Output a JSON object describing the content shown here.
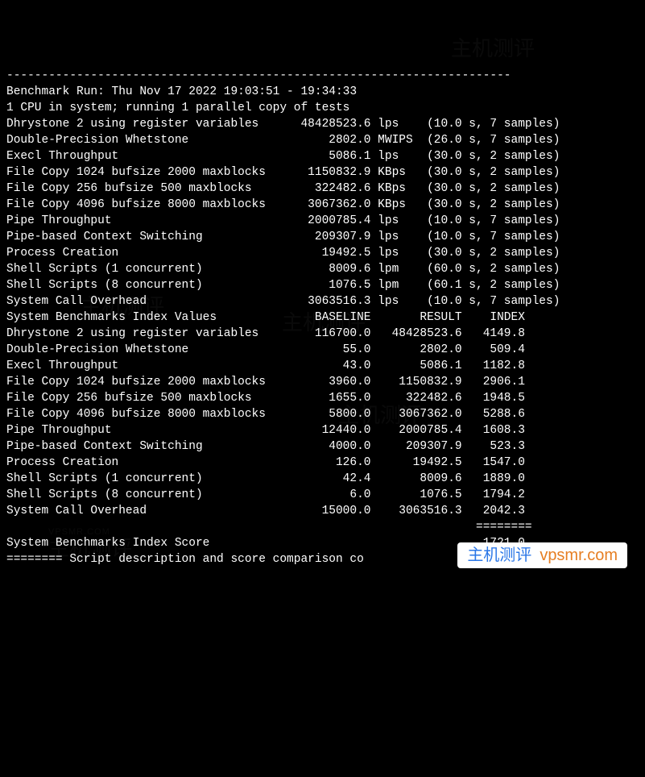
{
  "header": {
    "divider_top": "------------------------------------------------------------------------",
    "run_line": "Benchmark Run: Thu Nov 17 2022 19:03:51 - 19:34:33",
    "cpu_line": "1 CPU in system; running 1 parallel copy of tests"
  },
  "results": [
    {
      "name": "Dhrystone 2 using register variables",
      "value": "48428523.6",
      "unit": "lps",
      "time": "10.0",
      "samples": "7"
    },
    {
      "name": "Double-Precision Whetstone",
      "value": "2802.0",
      "unit": "MWIPS",
      "time": "26.0",
      "samples": "7"
    },
    {
      "name": "Execl Throughput",
      "value": "5086.1",
      "unit": "lps",
      "time": "30.0",
      "samples": "2"
    },
    {
      "name": "File Copy 1024 bufsize 2000 maxblocks",
      "value": "1150832.9",
      "unit": "KBps",
      "time": "30.0",
      "samples": "2"
    },
    {
      "name": "File Copy 256 bufsize 500 maxblocks",
      "value": "322482.6",
      "unit": "KBps",
      "time": "30.0",
      "samples": "2"
    },
    {
      "name": "File Copy 4096 bufsize 8000 maxblocks",
      "value": "3067362.0",
      "unit": "KBps",
      "time": "30.0",
      "samples": "2"
    },
    {
      "name": "Pipe Throughput",
      "value": "2000785.4",
      "unit": "lps",
      "time": "10.0",
      "samples": "7"
    },
    {
      "name": "Pipe-based Context Switching",
      "value": "209307.9",
      "unit": "lps",
      "time": "10.0",
      "samples": "7"
    },
    {
      "name": "Process Creation",
      "value": "19492.5",
      "unit": "lps",
      "time": "30.0",
      "samples": "2"
    },
    {
      "name": "Shell Scripts (1 concurrent)",
      "value": "8009.6",
      "unit": "lpm",
      "time": "60.0",
      "samples": "2"
    },
    {
      "name": "Shell Scripts (8 concurrent)",
      "value": "1076.5",
      "unit": "lpm",
      "time": "60.1",
      "samples": "2"
    },
    {
      "name": "System Call Overhead",
      "value": "3063516.3",
      "unit": "lps",
      "time": "10.0",
      "samples": "7"
    }
  ],
  "index_header": {
    "title": "System Benchmarks Index Values",
    "baseline": "BASELINE",
    "result": "RESULT",
    "index": "INDEX"
  },
  "index": [
    {
      "name": "Dhrystone 2 using register variables",
      "baseline": "116700.0",
      "result": "48428523.6",
      "index": "4149.8"
    },
    {
      "name": "Double-Precision Whetstone",
      "baseline": "55.0",
      "result": "2802.0",
      "index": "509.4"
    },
    {
      "name": "Execl Throughput",
      "baseline": "43.0",
      "result": "5086.1",
      "index": "1182.8"
    },
    {
      "name": "File Copy 1024 bufsize 2000 maxblocks",
      "baseline": "3960.0",
      "result": "1150832.9",
      "index": "2906.1"
    },
    {
      "name": "File Copy 256 bufsize 500 maxblocks",
      "baseline": "1655.0",
      "result": "322482.6",
      "index": "1948.5"
    },
    {
      "name": "File Copy 4096 bufsize 8000 maxblocks",
      "baseline": "5800.0",
      "result": "3067362.0",
      "index": "5288.6"
    },
    {
      "name": "Pipe Throughput",
      "baseline": "12440.0",
      "result": "2000785.4",
      "index": "1608.3"
    },
    {
      "name": "Pipe-based Context Switching",
      "baseline": "4000.0",
      "result": "209307.9",
      "index": "523.3"
    },
    {
      "name": "Process Creation",
      "baseline": "126.0",
      "result": "19492.5",
      "index": "1547.0"
    },
    {
      "name": "Shell Scripts (1 concurrent)",
      "baseline": "42.4",
      "result": "8009.6",
      "index": "1889.0"
    },
    {
      "name": "Shell Scripts (8 concurrent)",
      "baseline": "6.0",
      "result": "1076.5",
      "index": "1794.2"
    },
    {
      "name": "System Call Overhead",
      "baseline": "15000.0",
      "result": "3063516.3",
      "index": "2042.3"
    }
  ],
  "score": {
    "divider": "                                                                   ========",
    "label": "System Benchmarks Index Score",
    "value": "1721.0"
  },
  "footer": {
    "line": "======== Script description and score comparison co"
  },
  "watermark": {
    "text": "主机测评",
    "url": "vpsmr.com",
    "sub": "VPSMR.COM"
  }
}
